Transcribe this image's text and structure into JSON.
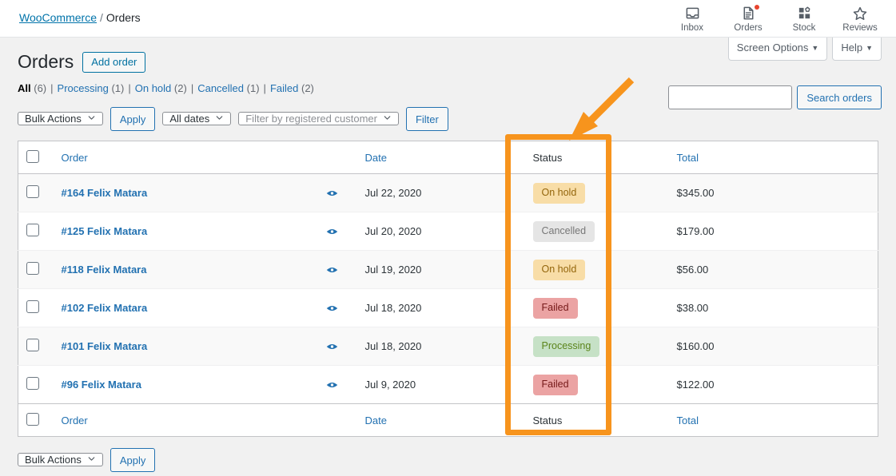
{
  "breadcrumb": {
    "root": "WooCommerce",
    "separator": "/",
    "current": "Orders"
  },
  "topnav": [
    {
      "label": "Inbox",
      "icon": "inbox-icon",
      "badge": false
    },
    {
      "label": "Orders",
      "icon": "orders-icon",
      "badge": true
    },
    {
      "label": "Stock",
      "icon": "stock-icon",
      "badge": false
    },
    {
      "label": "Reviews",
      "icon": "reviews-star-icon",
      "badge": false
    }
  ],
  "screen_meta": {
    "screen_options": "Screen Options",
    "help": "Help",
    "caret": "▼"
  },
  "header": {
    "title": "Orders",
    "add_order": "Add order"
  },
  "status_filters": [
    {
      "label": "All",
      "count": "(6)",
      "current": true
    },
    {
      "label": "Processing",
      "count": "(1)",
      "current": false
    },
    {
      "label": "On hold",
      "count": "(2)",
      "current": false
    },
    {
      "label": "Cancelled",
      "count": "(1)",
      "current": false
    },
    {
      "label": "Failed",
      "count": "(2)",
      "current": false
    }
  ],
  "search": {
    "value": "",
    "placeholder": "",
    "button": "Search orders"
  },
  "toolbar": {
    "bulk_actions": "Bulk Actions",
    "apply": "Apply",
    "all_dates": "All dates",
    "customer_placeholder": "Filter by registered customer",
    "filter": "Filter"
  },
  "table": {
    "columns": {
      "order": "Order",
      "date": "Date",
      "status": "Status",
      "total": "Total"
    },
    "rows": [
      {
        "order": "#164 Felix Matara",
        "date": "Jul 22, 2020",
        "status": "On hold",
        "status_key": "on-hold",
        "total": "$345.00"
      },
      {
        "order": "#125 Felix Matara",
        "date": "Jul 20, 2020",
        "status": "Cancelled",
        "status_key": "cancelled",
        "total": "$179.00"
      },
      {
        "order": "#118 Felix Matara",
        "date": "Jul 19, 2020",
        "status": "On hold",
        "status_key": "on-hold",
        "total": "$56.00"
      },
      {
        "order": "#102 Felix Matara",
        "date": "Jul 18, 2020",
        "status": "Failed",
        "status_key": "failed",
        "total": "$38.00"
      },
      {
        "order": "#101 Felix Matara",
        "date": "Jul 18, 2020",
        "status": "Processing",
        "status_key": "processing",
        "total": "$160.00"
      },
      {
        "order": "#96 Felix Matara",
        "date": "Jul 9, 2020",
        "status": "Failed",
        "status_key": "failed",
        "total": "$122.00"
      }
    ]
  },
  "bottom_toolbar": {
    "bulk_actions": "Bulk Actions",
    "apply": "Apply"
  },
  "colors": {
    "link": "#2271b1",
    "annotation": "#F7941D",
    "status_on_hold_bg": "#f8dda7",
    "status_on_hold_fg": "#94660c",
    "status_cancelled_bg": "#e5e5e5",
    "status_cancelled_fg": "#777777",
    "status_failed_bg": "#eba3a3",
    "status_failed_fg": "#761919",
    "status_processing_bg": "#c6e1c6",
    "status_processing_fg": "#5b841b"
  },
  "annotation": {
    "shape": "orange-rectangle-highlight",
    "arrow": "orange-arrow-pointing-down-left",
    "target": "status-column"
  }
}
